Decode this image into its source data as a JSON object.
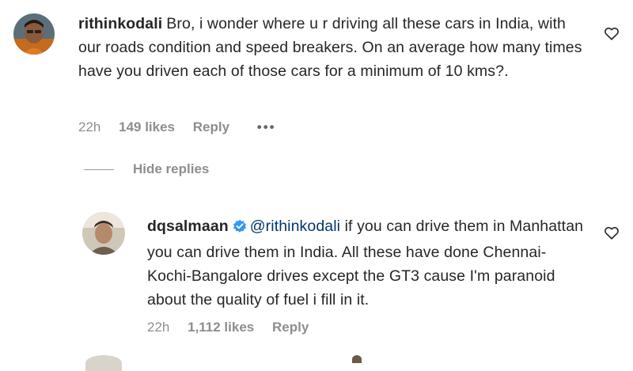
{
  "comment": {
    "username": "rithinkodali",
    "text": "Bro, i wonder where u r driving all these cars in India, with our roads condition and speed breakers. On an average how many times have you driven each of those cars for a minimum of 10 kms?.",
    "time": "22h",
    "likes": "149 likes",
    "reply_label": "Reply",
    "more_label": "•••"
  },
  "hide_replies_label": "Hide replies",
  "reply": {
    "username": "dqsalmaan",
    "mention": "@rithinkodali",
    "text": " if you can drive them in Manhattan you can drive them in India. All these have done Chennai-Kochi-Bangalore drives except the GT3 cause I'm paranoid about the quality of fuel i fill in it.",
    "time": "22h",
    "likes": "1,112 likes",
    "reply_label": "Reply"
  },
  "icons": {
    "like": "heart-outline-icon",
    "verified": "verified-badge-icon"
  },
  "colors": {
    "text": "#262626",
    "secondary": "#8e8e8e",
    "mention": "#00376b",
    "verified": "#3897f0"
  }
}
